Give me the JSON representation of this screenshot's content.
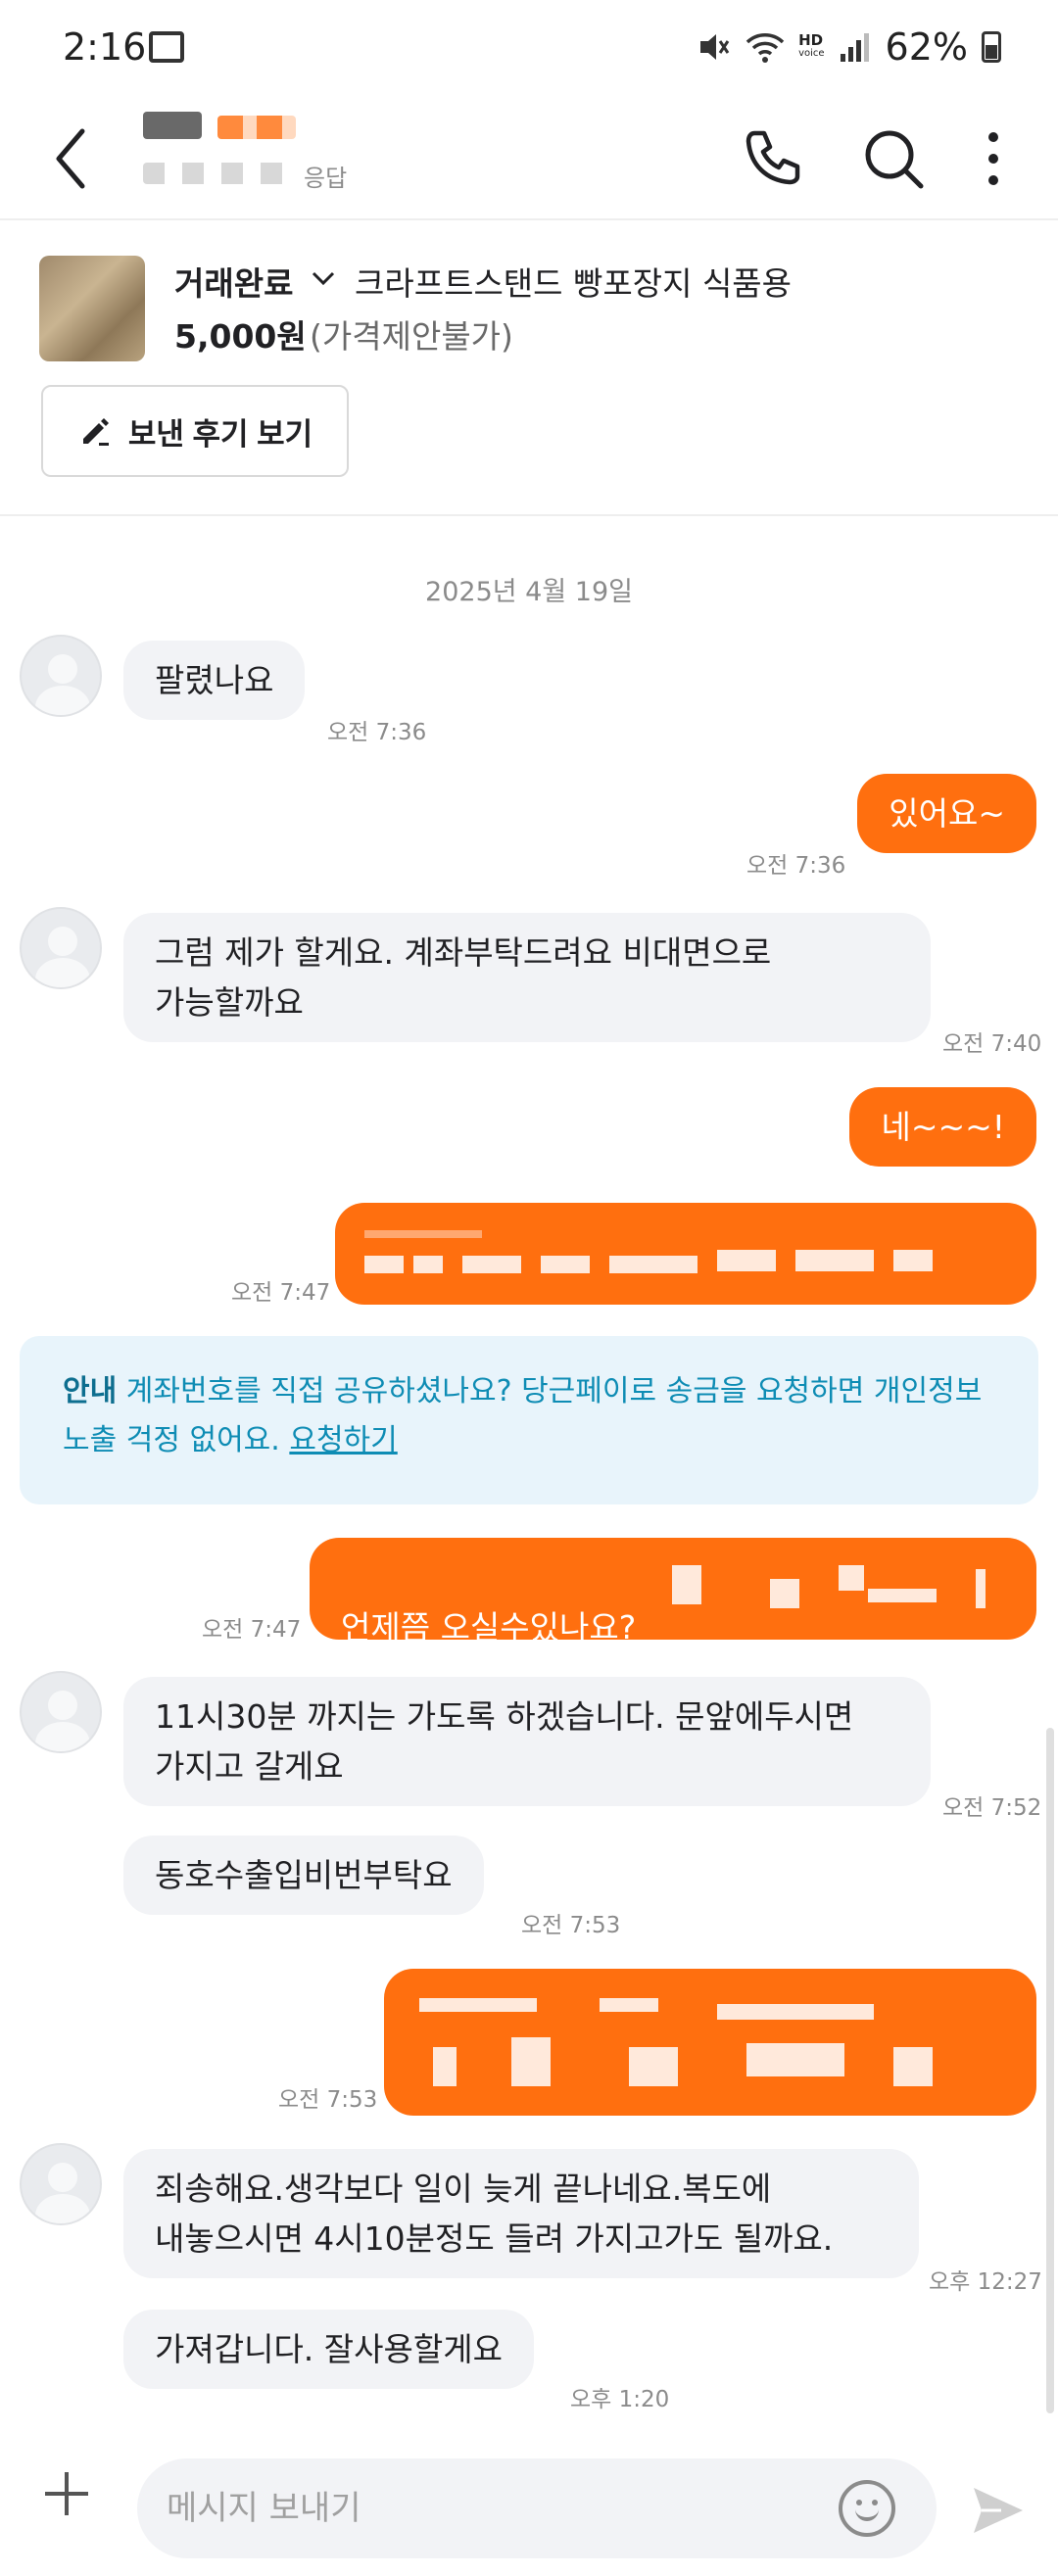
{
  "status_bar": {
    "time": "2:16",
    "battery": "62%",
    "hd_label": "HD",
    "voice_label": "voice"
  },
  "header": {
    "response_fragment": "응답"
  },
  "product": {
    "status": "거래완료",
    "title": "크라프트스탠드 빵포장지 식품용",
    "price": "5,000원",
    "price_note": "(가격제안불가)",
    "review_button": "보낸 후기 보기"
  },
  "chat": {
    "date": "2025년 4월 19일",
    "messages": [
      {
        "dir": "in",
        "text": "팔렸나요",
        "time": "오전 7:36"
      },
      {
        "dir": "out",
        "text": "있어요~",
        "time": "오전 7:36"
      },
      {
        "dir": "in",
        "text": "그럼 제가 할게요. 계좌부탁드려요 비대면으로\n가능할까요",
        "time": "오전 7:40"
      },
      {
        "dir": "out",
        "text": "네~~~!",
        "time": ""
      },
      {
        "dir": "out",
        "text": "-다",
        "time": "오전 7:47"
      },
      {
        "dir": "out",
        "text": "언제쯤 오실수있나요?",
        "time": "오전 7:47"
      },
      {
        "dir": "in",
        "text": "11시30분 까지는 가도록 하겠습니다. 문앞에두시면\n가지고 갈게요",
        "time": "오전 7:52"
      },
      {
        "dir": "in",
        "text": "동호수출입비번부탁요",
        "time": "오전 7:53"
      },
      {
        "dir": "out",
        "text": "",
        "time": "오전 7:53"
      },
      {
        "dir": "in",
        "text": "죄송해요.생각보다 일이 늦게 끝나네요.복도에\n내놓으시면 4시10분정도 들려 가지고가도 될까요.",
        "time": "오후 12:27"
      },
      {
        "dir": "in",
        "text": "가져갑니다. 잘사용할게요",
        "time": "오후 1:20"
      }
    ],
    "notice": {
      "label": "안내",
      "text": "계좌번호를 직접 공유하셨나요? 당근페이로 송금을 요청하면 개인정보 노출 걱정 없어요.",
      "link": "요청하기"
    }
  },
  "input": {
    "placeholder": "메시지 보내기"
  },
  "colors": {
    "accent": "#ff6f0f",
    "incoming_bubble": "#f2f3f6",
    "notice_bg": "#e8f4fb",
    "notice_text": "#0e8cb4"
  }
}
